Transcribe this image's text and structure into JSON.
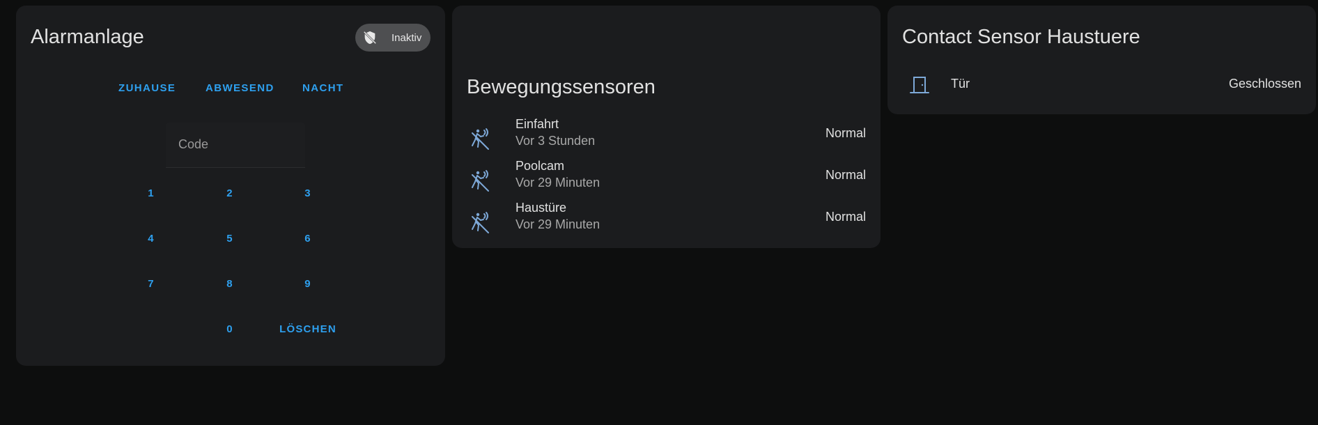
{
  "alarm": {
    "title": "Alarmanlage",
    "status_badge": "Inaktiv",
    "status_icon": "shield-off-icon",
    "modes": [
      "ZUHAUSE",
      "ABWESEND",
      "NACHT"
    ],
    "code_placeholder": "Code",
    "keypad": [
      "1",
      "2",
      "3",
      "4",
      "5",
      "6",
      "7",
      "8",
      "9",
      "0"
    ],
    "clear_label": "LÖSCHEN",
    "accent_color": "#2ea0ef"
  },
  "motion": {
    "title": "Bewegungssensoren",
    "icon": "motion-sensor-icon",
    "sensors": [
      {
        "name": "Einfahrt",
        "last_changed": "Vor 3 Stunden",
        "state": "Normal"
      },
      {
        "name": "Poolcam",
        "last_changed": "Vor 29 Minuten",
        "state": "Normal"
      },
      {
        "name": "Haustüre",
        "last_changed": "Vor 29 Minuten",
        "state": "Normal"
      }
    ]
  },
  "contact": {
    "title": "Contact Sensor Haustuere",
    "icon": "door-closed-icon",
    "entity": {
      "name": "Tür",
      "state": "Geschlossen"
    },
    "icon_color": "#7ea9d8"
  }
}
